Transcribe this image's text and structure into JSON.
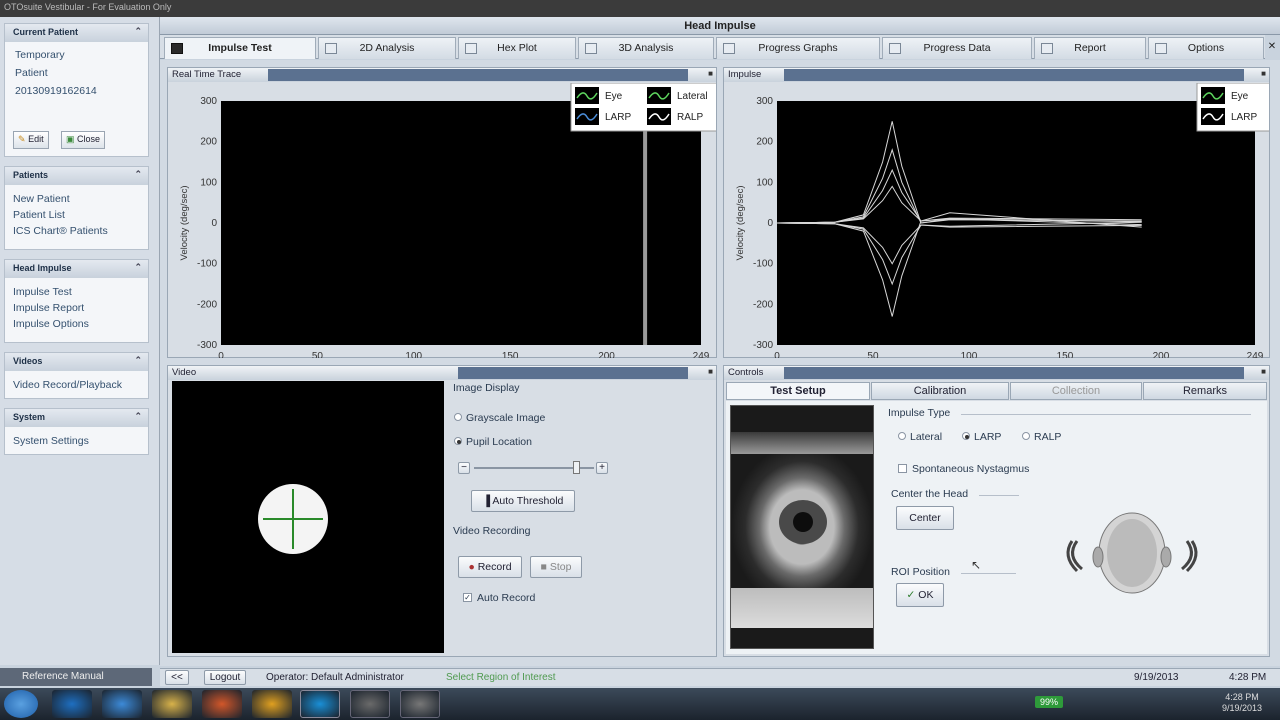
{
  "window": {
    "app_title": "OTOsuite Vestibular - For Evaluation Only",
    "module_title": "Head Impulse",
    "close_glyph": "✕"
  },
  "sidebar": {
    "current_patient": {
      "header": "Current Patient",
      "lines": [
        "Temporary",
        "Patient",
        "20130919162614"
      ],
      "edit_label": "Edit",
      "close_label": "Close"
    },
    "patients": {
      "header": "Patients",
      "items": [
        "New Patient",
        "Patient List",
        "ICS Chart® Patients"
      ]
    },
    "head_impulse": {
      "header": "Head Impulse",
      "items": [
        "Impulse Test",
        "Impulse Report",
        "Impulse Options"
      ]
    },
    "videos": {
      "header": "Videos",
      "items": [
        "Video Record/Playback"
      ]
    },
    "system": {
      "header": "System",
      "items": [
        "System Settings"
      ]
    },
    "reference_manual": "Reference Manual"
  },
  "tabs": [
    "Impulse Test",
    "2D Analysis",
    "Hex Plot",
    "3D Analysis",
    "Progress Graphs",
    "Progress Data",
    "Report",
    "Options"
  ],
  "panels": {
    "realtime_title": "Real Time Trace",
    "impulse_title": "Impulse",
    "video_title": "Video",
    "controls_title": "Controls"
  },
  "chart_data": [
    {
      "type": "line",
      "title": "Real Time Trace",
      "ylabel": "Velocity (deg/sec)",
      "xlim": [
        0,
        249
      ],
      "ylim": [
        -300,
        300
      ],
      "xticks": [
        0,
        50,
        100,
        150,
        200,
        249
      ],
      "yticks": [
        300,
        200,
        100,
        0,
        -100,
        -200,
        -300
      ],
      "legend": [
        {
          "name": "Eye",
          "color": "#5dd35d"
        },
        {
          "name": "LARP",
          "color": "#4a8bd6"
        },
        {
          "name": "Lateral",
          "color": "#5dd35d"
        },
        {
          "name": "RALP",
          "color": "#ffffff"
        }
      ],
      "legend_position": "top-right",
      "cursor_x": 220,
      "series": []
    },
    {
      "type": "line",
      "title": "Impulse",
      "ylabel": "Velocity (deg/sec)",
      "xlim": [
        0,
        249
      ],
      "ylim": [
        -300,
        300
      ],
      "xticks": [
        0,
        50,
        100,
        150,
        200,
        249
      ],
      "yticks": [
        300,
        200,
        100,
        0,
        -100,
        -200,
        -300
      ],
      "legend": [
        {
          "name": "Eye",
          "color": "#5dd35d"
        },
        {
          "name": "LARP",
          "color": "#ffffff"
        }
      ],
      "legend_position": "top-right",
      "series": [
        {
          "peak": 250,
          "x": [
            0,
            30,
            45,
            55,
            60,
            65,
            75,
            90,
            190
          ],
          "y": [
            0,
            2,
            20,
            150,
            250,
            140,
            0,
            10,
            3
          ]
        },
        {
          "peak": 180,
          "x": [
            0,
            30,
            45,
            55,
            60,
            65,
            75,
            90,
            190
          ],
          "y": [
            0,
            2,
            15,
            110,
            180,
            100,
            0,
            8,
            5
          ]
        },
        {
          "peak": 130,
          "x": [
            0,
            30,
            45,
            55,
            60,
            65,
            75,
            90,
            190
          ],
          "y": [
            0,
            2,
            12,
            80,
            130,
            75,
            5,
            12,
            8
          ]
        },
        {
          "peak": 90,
          "x": [
            0,
            30,
            45,
            55,
            60,
            65,
            75,
            90,
            190
          ],
          "y": [
            0,
            2,
            10,
            55,
            90,
            50,
            5,
            10,
            -4
          ]
        },
        {
          "peak": -100,
          "x": [
            0,
            30,
            45,
            55,
            60,
            65,
            75,
            90,
            190
          ],
          "y": [
            0,
            -2,
            -12,
            -60,
            -100,
            -55,
            -5,
            -8,
            2
          ]
        },
        {
          "peak": -150,
          "x": [
            0,
            30,
            45,
            55,
            60,
            65,
            75,
            90,
            190
          ],
          "y": [
            0,
            -2,
            -15,
            -90,
            -150,
            -85,
            -5,
            -10,
            -6
          ]
        },
        {
          "peak": -230,
          "x": [
            0,
            30,
            45,
            55,
            60,
            65,
            75,
            90,
            190
          ],
          "y": [
            0,
            -2,
            -20,
            -140,
            -230,
            -130,
            5,
            25,
            -10
          ]
        }
      ]
    }
  ],
  "video": {
    "image_display_label": "Image Display",
    "grayscale_label": "Grayscale Image",
    "pupil_label": "Pupil Location",
    "auto_threshold_label": "Auto Threshold",
    "video_recording_label": "Video Recording",
    "record_label": "Record",
    "stop_label": "Stop",
    "auto_record_label": "Auto Record",
    "slider_minus": "−",
    "slider_plus": "+",
    "threshold_level": 0.85
  },
  "controls": {
    "tabs": [
      "Test Setup",
      "Calibration",
      "Collection",
      "Remarks"
    ],
    "impulse_type_label": "Impulse Type",
    "impulse_types": [
      "Lateral",
      "LARP",
      "RALP"
    ],
    "impulse_type_selected": "LARP",
    "spontaneous_label": "Spontaneous Nystagmus",
    "center_head_label": "Center the Head",
    "center_button": "Center",
    "roi_label": "ROI Position",
    "ok_button": "OK"
  },
  "status": {
    "nav_back": "<<",
    "logout": "Logout",
    "operator": "Operator: Default Administrator",
    "message": "Select Region of Interest",
    "date": "9/19/2013",
    "time": "4:28 PM"
  },
  "taskbar": {
    "battery": "99%",
    "clock_time": "4:28 PM",
    "clock_date": "9/19/2013",
    "colors": [
      "#1e6fc1",
      "#3c8ad8",
      "#d8b24a",
      "#d2572a",
      "#e0a020",
      "#1a8fd6",
      "#6a6a6a",
      "#777",
      "#777"
    ]
  }
}
